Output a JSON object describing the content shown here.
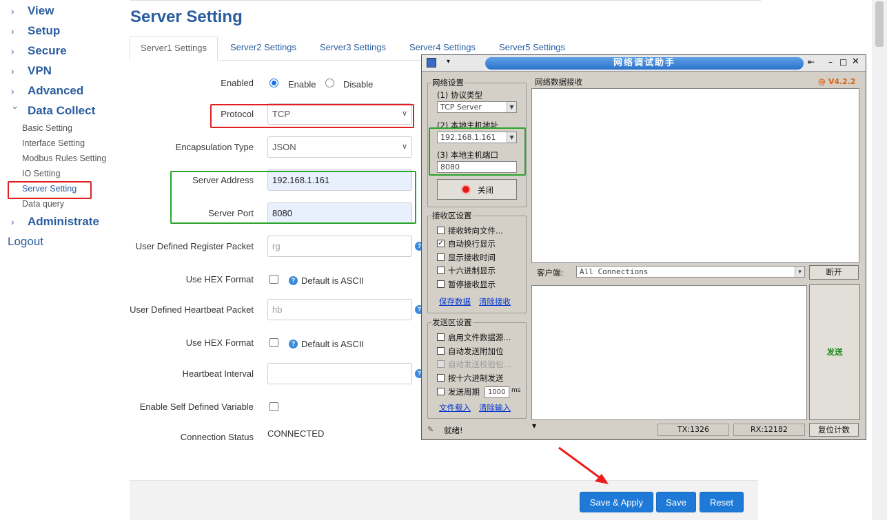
{
  "sidebar": {
    "view": "View",
    "setup": "Setup",
    "secure": "Secure",
    "vpn": "VPN",
    "advanced": "Advanced",
    "data_collect": "Data Collect",
    "basic_setting": "Basic Setting",
    "interface_setting": "Interface Setting",
    "modbus_rules": "Modbus Rules Setting",
    "io_setting": "IO Setting",
    "server_setting": "Server Setting",
    "data_query": "Data query",
    "administrate": "Administrate",
    "logout": "Logout"
  },
  "page": {
    "title": "Server Setting",
    "tabs": [
      "Server1 Settings",
      "Server2 Settings",
      "Server3 Settings",
      "Server4 Settings",
      "Server5 Settings"
    ]
  },
  "form": {
    "enabled_label": "Enabled",
    "enable": "Enable",
    "disable": "Disable",
    "protocol_label": "Protocol",
    "protocol_value": "TCP",
    "encap_label": "Encapsulation Type",
    "encap_value": "JSON",
    "server_address_label": "Server Address",
    "server_address_value": "192.168.1.161",
    "server_port_label": "Server Port",
    "server_port_value": "8080",
    "register_label": "User Defined Register Packet",
    "register_placeholder": "rg",
    "hex1_label": "Use HEX Format",
    "hex1_hint": "Default is ASCII",
    "heartbeat_label": "User Defined Heartbeat Packet",
    "heartbeat_placeholder": "hb",
    "hex2_label": "Use HEX Format",
    "hex2_hint": "Default is ASCII",
    "interval_label": "Heartbeat Interval",
    "selfvar_label": "Enable Self Defined Variable",
    "status_label": "Connection Status",
    "status_value": "CONNECTED"
  },
  "footer": {
    "save_apply": "Save & Apply",
    "save": "Save",
    "reset": "Reset"
  },
  "tool": {
    "title": "网络调试助手",
    "version": "@ V4.2.2",
    "net_settings": "网络设置",
    "proto_type": "(1) 协议类型",
    "proto_value": "TCP Server",
    "local_ip_label": "(2) 本地主机地址",
    "local_ip": "192.168.1.161",
    "local_port_label": "(3) 本地主机端口",
    "local_port": "8080",
    "close_btn": "关闭",
    "recv_area": "接收区设置",
    "recv_opts": [
      "接收转向文件...",
      "自动换行显示",
      "显示接收时间",
      "十六进制显示",
      "暂停接收显示"
    ],
    "save_data": "保存数据",
    "clear_recv": "清除接收",
    "send_area": "发送区设置",
    "send_opts": [
      "启用文件数据源...",
      "自动发送附加位",
      "自动发送校验包...",
      "按十六进制发送",
      "发送周期"
    ],
    "period_value": "1000",
    "period_unit": "ms",
    "load_file": "文件载入",
    "clear_input": "清除输入",
    "recv_data_label": "网络数据接收",
    "client_label": "客户端:",
    "client_value": "All Connections",
    "disconnect": "断开",
    "send": "发送",
    "ready": "就绪!",
    "tx": "TX:1326",
    "rx": "RX:12182",
    "reset_count": "复位计数"
  },
  "colors": {
    "brand_blue": "#2a5d9f",
    "button_blue": "#1e7ad6",
    "highlight_red": "#e02020",
    "highlight_green": "#2aa52a"
  }
}
